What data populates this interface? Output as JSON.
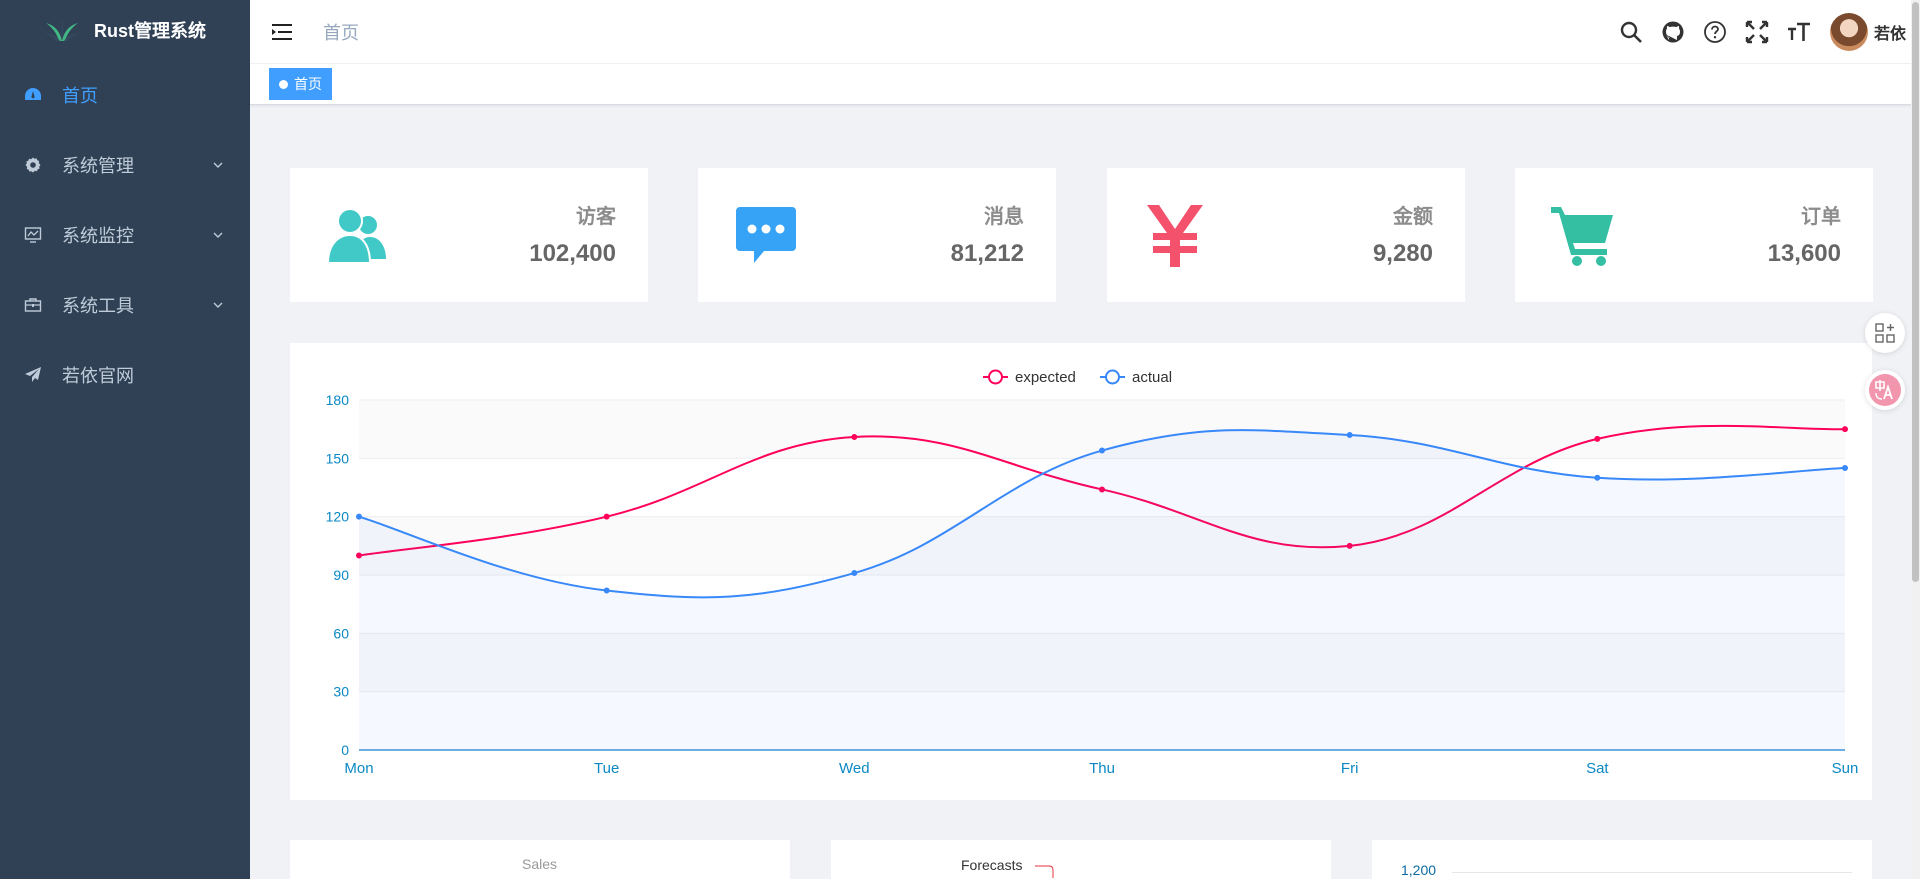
{
  "sidebar": {
    "title": "Rust管理系统",
    "items": [
      {
        "label": "首页",
        "icon": "dashboard-icon",
        "active": true,
        "has_children": false
      },
      {
        "label": "系统管理",
        "icon": "gear-icon",
        "active": false,
        "has_children": true
      },
      {
        "label": "系统监控",
        "icon": "monitor-icon",
        "active": false,
        "has_children": true
      },
      {
        "label": "系统工具",
        "icon": "toolbox-icon",
        "active": false,
        "has_children": true
      },
      {
        "label": "若依官网",
        "icon": "paper-plane-icon",
        "active": false,
        "has_children": false
      }
    ]
  },
  "navbar": {
    "breadcrumb": "首页",
    "username": "若依",
    "icons": [
      "search-icon",
      "github-icon",
      "help-icon",
      "fullscreen-icon",
      "font-size-icon"
    ]
  },
  "tags": [
    {
      "label": "首页",
      "active": true
    }
  ],
  "stats": [
    {
      "label": "访客",
      "value": "102,400",
      "icon": "people-icon",
      "color": "#40c9c6"
    },
    {
      "label": "消息",
      "value": "81,212",
      "icon": "message-icon",
      "color": "#36a3f7"
    },
    {
      "label": "金额",
      "value": "9,280",
      "icon": "money-icon",
      "color": "#f4516c"
    },
    {
      "label": "订单",
      "value": "13,600",
      "icon": "shopping-cart-icon",
      "color": "#34bfa3"
    }
  ],
  "chart_data": {
    "type": "line",
    "categories": [
      "Mon",
      "Tue",
      "Wed",
      "Thu",
      "Fri",
      "Sat",
      "Sun"
    ],
    "series": [
      {
        "name": "expected",
        "values": [
          100,
          120,
          161,
          134,
          105,
          160,
          165
        ],
        "color": "#FF005A"
      },
      {
        "name": "actual",
        "values": [
          120,
          82,
          91,
          154,
          162,
          140,
          145
        ],
        "color": "#3888fa"
      }
    ],
    "ylim": [
      0,
      180
    ],
    "yticks": [
      0,
      30,
      60,
      90,
      120,
      150,
      180
    ],
    "legend": "top-center",
    "grid": true
  },
  "bottom": {
    "sales_label": "Sales",
    "forecasts_label": "Forecasts",
    "bar_top_tick": "1,200"
  },
  "colors": {
    "sidebar_bg": "#304156",
    "accent": "#409eff"
  }
}
